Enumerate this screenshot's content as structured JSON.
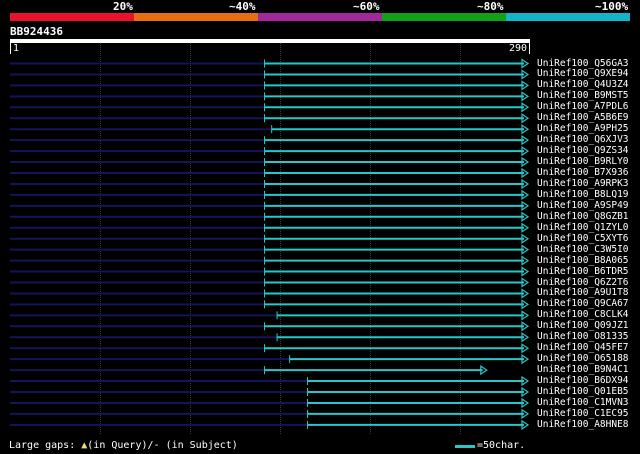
{
  "colors": {
    "background": "#000000",
    "hit_line": "#28c8c8",
    "gap_line": "#14145a",
    "identity_bands": [
      "#e8122d",
      "#e86e14",
      "#a0289b",
      "#14a014",
      "#14b4c8"
    ]
  },
  "identity_scale": {
    "labels": [
      "20%",
      "~40%",
      "~60%",
      "~80%",
      "~100%"
    ]
  },
  "query": {
    "id": "BB924436",
    "start": "1",
    "end": "290",
    "length": 290
  },
  "hits": [
    {
      "name": "UniRef100_Q56GA3",
      "start": 143,
      "end": 290
    },
    {
      "name": "UniRef100_Q9XE94",
      "start": 143,
      "end": 290
    },
    {
      "name": "UniRef100_Q4U3Z4",
      "start": 143,
      "end": 290
    },
    {
      "name": "UniRef100_B9MST5",
      "start": 143,
      "end": 290
    },
    {
      "name": "UniRef100_A7PDL6",
      "start": 143,
      "end": 290
    },
    {
      "name": "UniRef100_A5B6E9",
      "start": 143,
      "end": 290
    },
    {
      "name": "UniRef100_A9PH25",
      "start": 147,
      "end": 290
    },
    {
      "name": "UniRef100_Q6XJV3",
      "start": 143,
      "end": 290
    },
    {
      "name": "UniRef100_Q9ZS34",
      "start": 143,
      "end": 290
    },
    {
      "name": "UniRef100_B9RLY0",
      "start": 143,
      "end": 290
    },
    {
      "name": "UniRef100_B7X936",
      "start": 143,
      "end": 290
    },
    {
      "name": "UniRef100_A9RPK3",
      "start": 143,
      "end": 290
    },
    {
      "name": "UniRef100_B8LQ19",
      "start": 143,
      "end": 290
    },
    {
      "name": "UniRef100_A9SP49",
      "start": 143,
      "end": 290
    },
    {
      "name": "UniRef100_Q8GZB1",
      "start": 143,
      "end": 290
    },
    {
      "name": "UniRef100_Q1ZYL0",
      "start": 143,
      "end": 290
    },
    {
      "name": "UniRef100_C5XYT6",
      "start": 143,
      "end": 290
    },
    {
      "name": "UniRef100_C3W5I0",
      "start": 143,
      "end": 290
    },
    {
      "name": "UniRef100_B8A065",
      "start": 143,
      "end": 290
    },
    {
      "name": "UniRef100_B6TDR5",
      "start": 143,
      "end": 290
    },
    {
      "name": "UniRef100_Q6Z2T6",
      "start": 143,
      "end": 290
    },
    {
      "name": "UniRef100_A9U1T8",
      "start": 143,
      "end": 290
    },
    {
      "name": "UniRef100_Q9CA67",
      "start": 143,
      "end": 290
    },
    {
      "name": "UniRef100_C8CLK4",
      "start": 150,
      "end": 290
    },
    {
      "name": "UniRef100_Q09JZ1",
      "start": 143,
      "end": 290
    },
    {
      "name": "UniRef100_O81335",
      "start": 150,
      "end": 290
    },
    {
      "name": "UniRef100_Q45FE7",
      "start": 143,
      "end": 290
    },
    {
      "name": "UniRef100_O65188",
      "start": 157,
      "end": 290
    },
    {
      "name": "UniRef100_B9N4C1",
      "start": 143,
      "end": 267
    },
    {
      "name": "UniRef100_B6DX94",
      "start": 167,
      "end": 290
    },
    {
      "name": "UniRef100_Q01EB5",
      "start": 167,
      "end": 290
    },
    {
      "name": "UniRef100_C1MVN3",
      "start": 167,
      "end": 290
    },
    {
      "name": "UniRef100_C1EC95",
      "start": 167,
      "end": 290
    },
    {
      "name": "UniRef100_A8HNE8",
      "start": 167,
      "end": 290
    }
  ],
  "footer": {
    "large_gaps_prefix": "Large gaps: ",
    "query_marker": "▲",
    "query_text": "(in Query)/",
    "subject_marker": "-",
    "subject_text": " (in Subject)",
    "scale_text": "=50char."
  }
}
